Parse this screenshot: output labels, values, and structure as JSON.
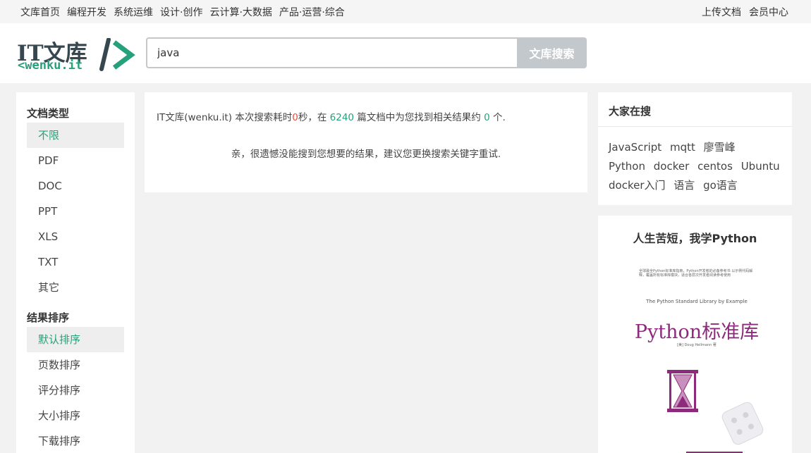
{
  "topnav": {
    "left": [
      "文库首页",
      "编程开发",
      "系统运维",
      "设计·创作",
      "云计算·大数据",
      "产品·运营·综合"
    ],
    "right": [
      "上传文档",
      "会员中心"
    ]
  },
  "logo": {
    "main": "IT文库",
    "sub": "<wenku.it"
  },
  "search": {
    "value": "java",
    "button": "文库搜索"
  },
  "sidebar": {
    "doc_type_title": "文档类型",
    "doc_types": [
      "不限",
      "PDF",
      "DOC",
      "PPT",
      "XLS",
      "TXT",
      "其它"
    ],
    "sort_title": "结果排序",
    "sorts": [
      "默认排序",
      "页数排序",
      "评分排序",
      "大小排序",
      "下载排序"
    ]
  },
  "results": {
    "prefix": "IT文库(wenku.it) 本次搜索耗时",
    "time": "0",
    "mid1": "秒，在",
    "count": "6240",
    "mid2": "篇文档中为您找到相关结果约",
    "found": "0",
    "suffix": "个.",
    "empty": "亲，很遗憾没能搜到您想要的结果，建议您更换搜索关键字重试."
  },
  "hot": {
    "title": "大家在搜",
    "tags": [
      "JavaScript",
      "mqtt",
      "廖雪峰",
      "Python",
      "docker",
      "centos",
      "Ubuntu",
      "docker入门",
      "语言",
      "go语言"
    ]
  },
  "book": {
    "heading": "人生苦短，我学Python",
    "cover_tiny": "全球最全Python标准库指南，Python开发者的必备参考书 以示例代码解释，覆盖所有标准库模块，适合各层次开发者阅读参考使用",
    "cover_series": "The Python Standard Library by Example",
    "cover_title": "Python标准库",
    "cover_author": "[美] Doug Hellmann 著"
  }
}
